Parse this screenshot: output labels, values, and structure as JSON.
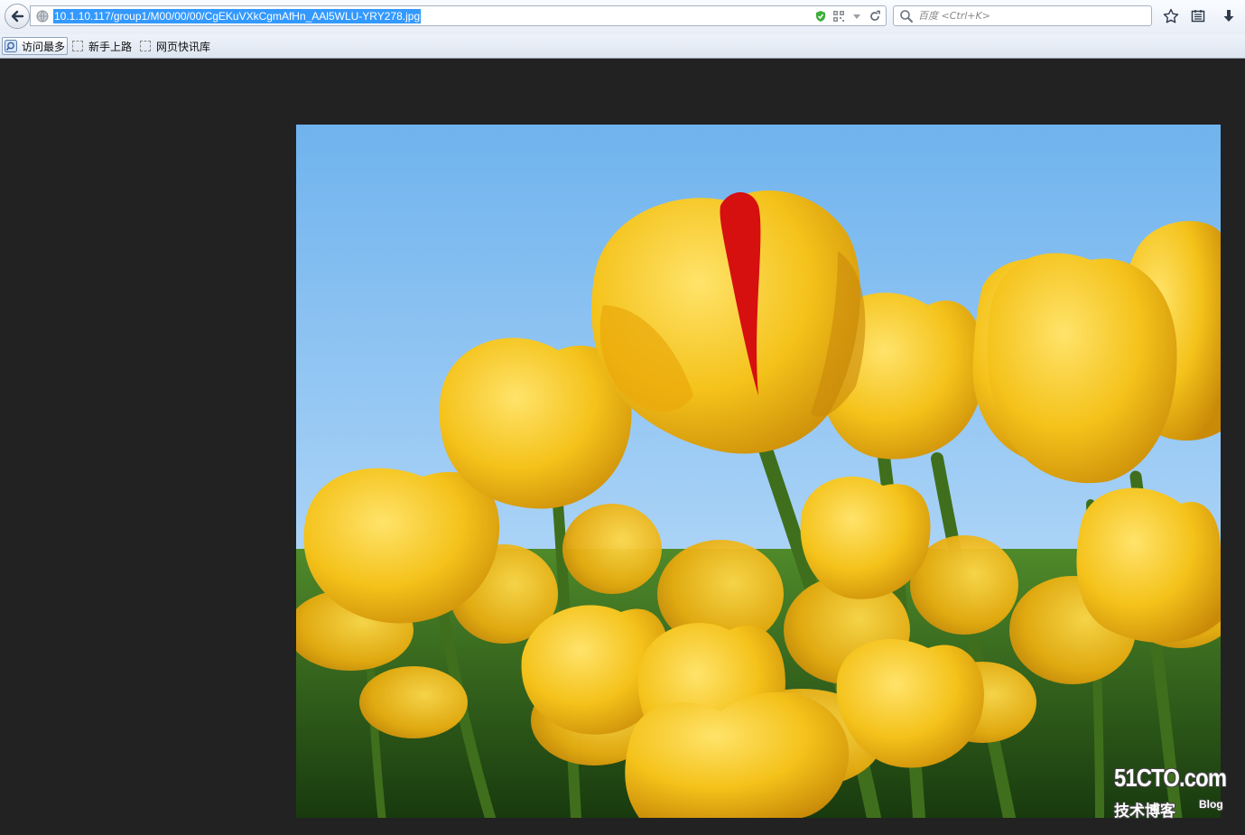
{
  "nav": {
    "url": "10.1.10.117/group1/M00/00/00/CgEKuVXkCgmAfHn_AAl5WLU-YRY278.jpg",
    "search_placeholder": "百度 <Ctrl+K>",
    "icons": [
      "back-arrow-icon",
      "globe-icon",
      "shield-check-icon",
      "qr-code-icon",
      "dropdown-arrow-icon",
      "reload-icon",
      "search-icon",
      "bookmark-star-icon",
      "reading-list-icon",
      "download-icon"
    ]
  },
  "bookmarks": [
    {
      "label": "访问最多",
      "icon": "most-visited-icon"
    },
    {
      "label": "新手上路",
      "icon": "folder-icon"
    },
    {
      "label": "网页快讯库",
      "icon": "folder-icon"
    }
  ],
  "viewer": {
    "background": "#222222",
    "image_subject": "yellow-tulips-photo"
  },
  "watermark": {
    "main": "51CTO.com",
    "sub": "技术博客",
    "blog": "Blog"
  }
}
